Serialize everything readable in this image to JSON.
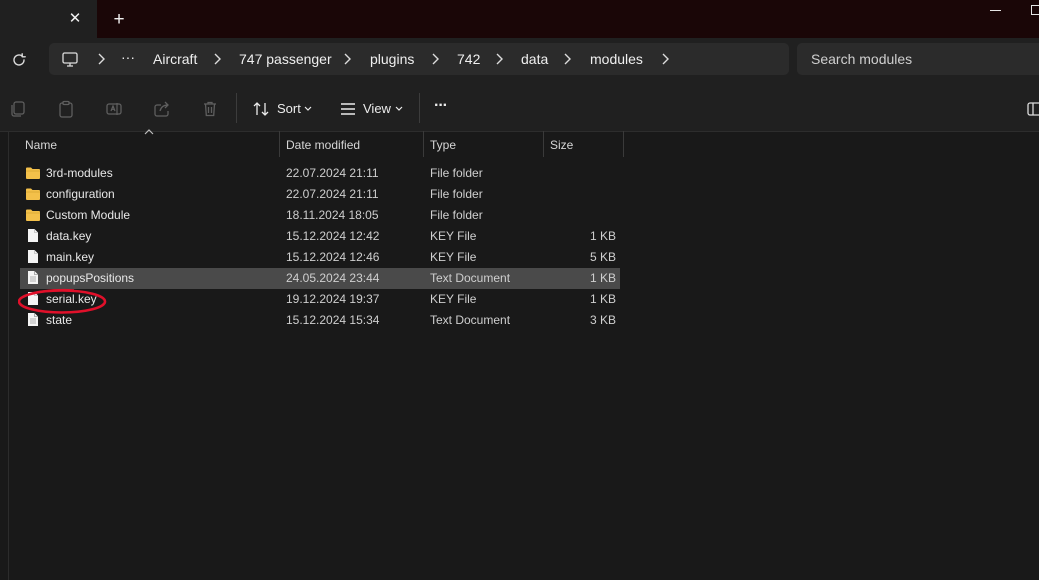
{
  "titlebar": {
    "close_tab_glyph": "✕",
    "new_tab_glyph": "+"
  },
  "breadcrumb": {
    "overflow": "···",
    "items": [
      "Aircraft",
      "747 passenger",
      "plugins",
      "742",
      "data",
      "modules"
    ]
  },
  "search": {
    "placeholder": "Search modules"
  },
  "toolbar": {
    "sort_label": "Sort",
    "view_label": "View",
    "more_glyph": "···"
  },
  "columns": {
    "name": "Name",
    "date": "Date modified",
    "type": "Type",
    "size": "Size"
  },
  "files": [
    {
      "name": "3rd-modules",
      "date": "22.07.2024 21:11",
      "type": "File folder",
      "size": "",
      "icon": "folder-icon"
    },
    {
      "name": "configuration",
      "date": "22.07.2024 21:11",
      "type": "File folder",
      "size": "",
      "icon": "folder-icon"
    },
    {
      "name": "Custom Module",
      "date": "18.11.2024 18:05",
      "type": "File folder",
      "size": "",
      "icon": "folder-icon"
    },
    {
      "name": "data.key",
      "date": "15.12.2024 12:42",
      "type": "KEY File",
      "size": "1 KB",
      "icon": "file-icon"
    },
    {
      "name": "main.key",
      "date": "15.12.2024 12:46",
      "type": "KEY File",
      "size": "5 KB",
      "icon": "file-icon"
    },
    {
      "name": "popupsPositions",
      "date": "24.05.2024 23:44",
      "type": "Text Document",
      "size": "1 KB",
      "icon": "text-file-icon",
      "selected": true
    },
    {
      "name": "serial.key",
      "date": "19.12.2024 19:37",
      "type": "KEY File",
      "size": "1 KB",
      "icon": "file-icon",
      "annotated": true
    },
    {
      "name": "state",
      "date": "15.12.2024 15:34",
      "type": "Text Document",
      "size": "3 KB",
      "icon": "text-file-icon"
    }
  ],
  "colors": {
    "folder": "#f3c04a",
    "selection": "#4a4a4a",
    "annotation": "#e0102a",
    "titlebar": "#1a0607"
  }
}
